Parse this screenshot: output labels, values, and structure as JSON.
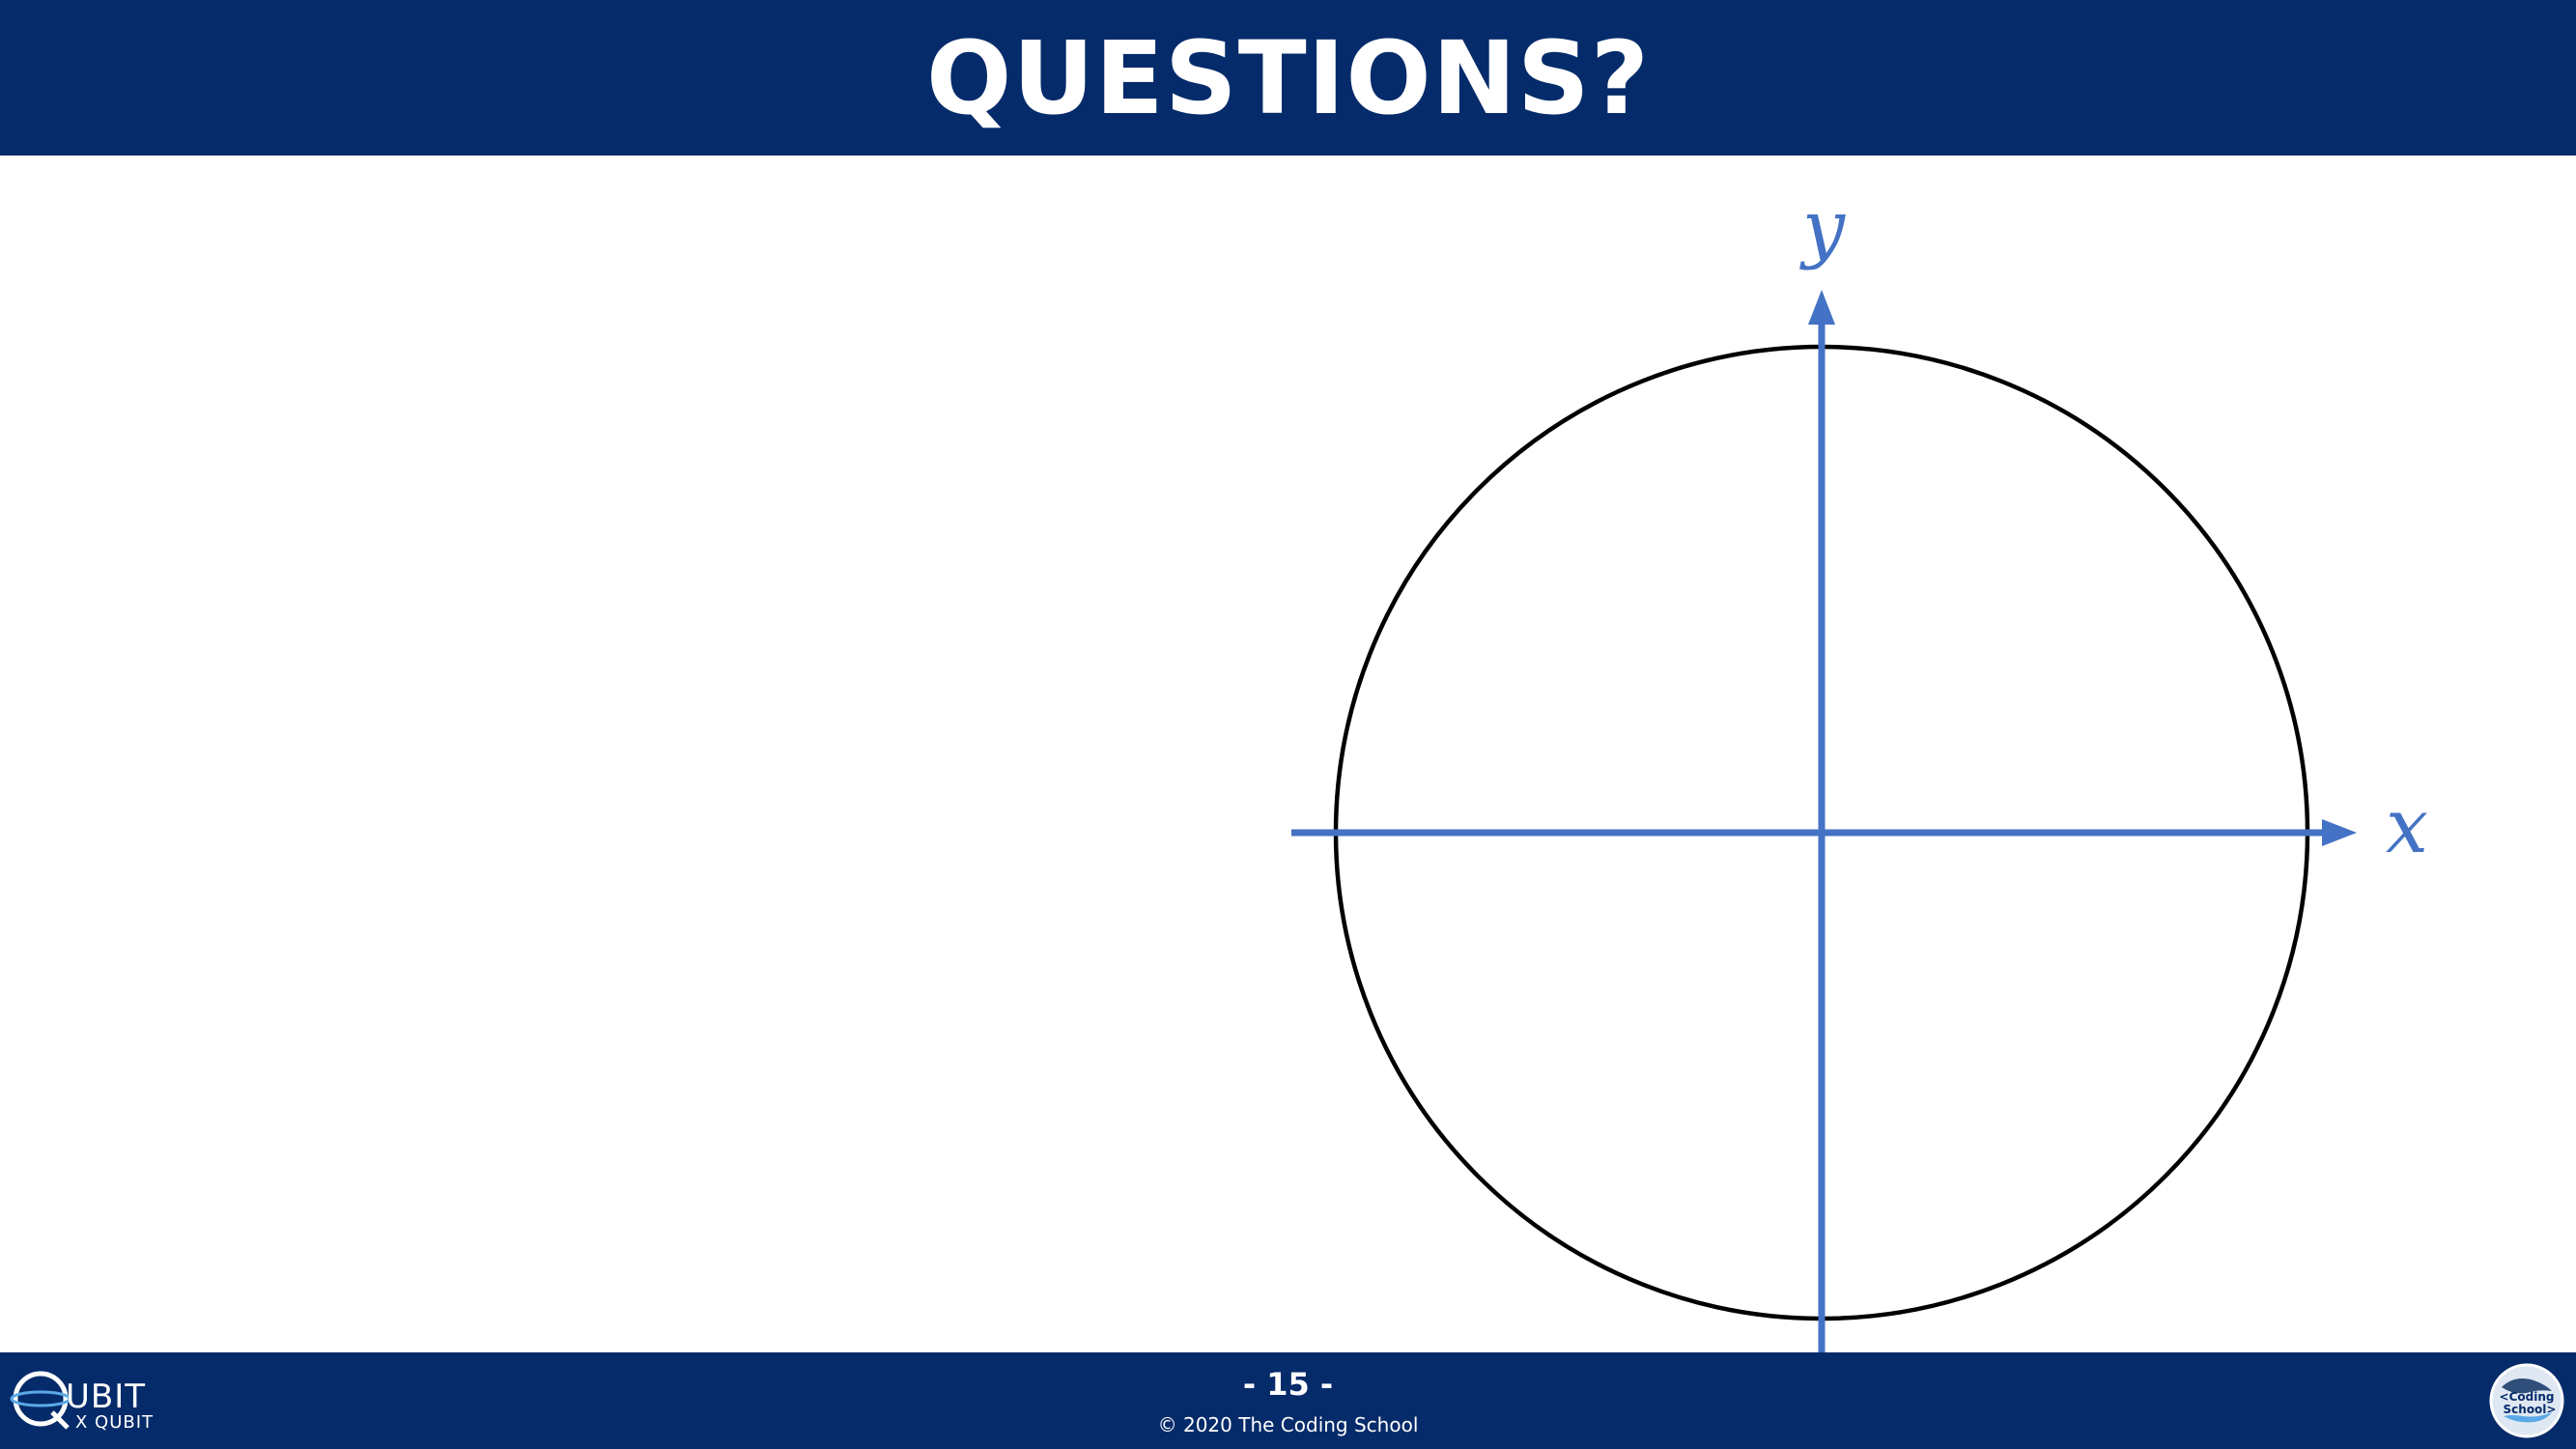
{
  "slide": {
    "title": "QUESTIONS?",
    "page_number": "- 15 -",
    "copyright": "© 2020 The Coding School"
  },
  "diagram": {
    "x_label": "x",
    "y_label": "y"
  },
  "logos": {
    "left_main": "UBIT",
    "left_sub": "X QUBIT",
    "right_line1": "<Coding",
    "right_line2": "School>"
  },
  "colors": {
    "header_bg": "#062b6a",
    "axis": "#4472c4",
    "circle": "#000000"
  }
}
